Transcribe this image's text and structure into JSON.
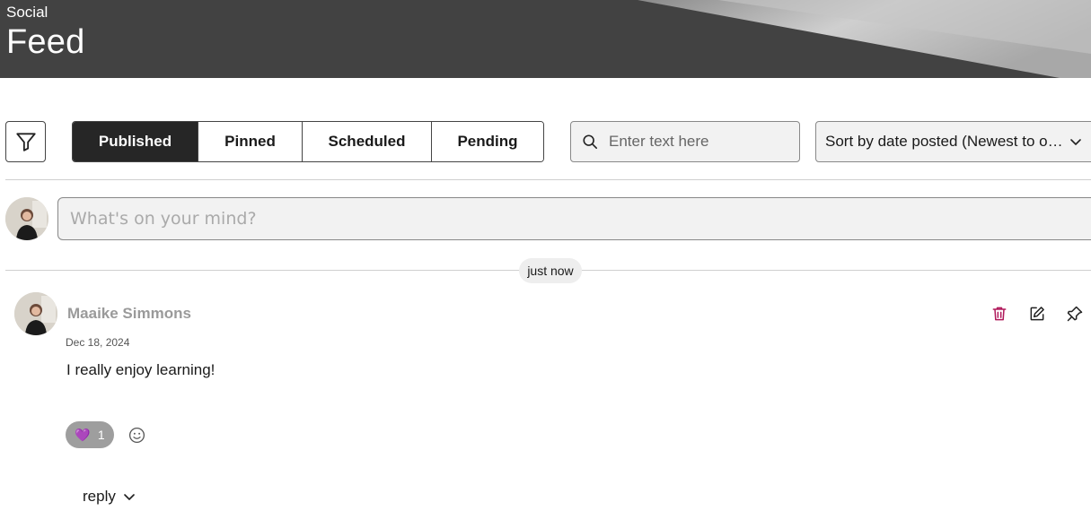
{
  "header": {
    "supertitle": "Social",
    "title": "Feed"
  },
  "toolbar": {
    "filter_icon": "filter-icon",
    "tabs": [
      {
        "label": "Published",
        "active": true
      },
      {
        "label": "Pinned",
        "active": false
      },
      {
        "label": "Scheduled",
        "active": false
      },
      {
        "label": "Pending",
        "active": false
      }
    ],
    "search": {
      "icon": "search-icon",
      "placeholder": "Enter text here",
      "value": ""
    },
    "sort": {
      "label": "Sort by date posted (Newest to oldest)",
      "icon": "chevron-down-icon"
    }
  },
  "composer": {
    "placeholder": "What's on your mind?",
    "value": ""
  },
  "separator": {
    "time_label": "just now"
  },
  "post": {
    "author": "Maaike Simmons",
    "date": "Dec 18, 2024",
    "body": "I really enjoy learning!",
    "actions": [
      "trash-icon",
      "edit-icon",
      "pin-icon"
    ],
    "reaction": {
      "emoji": "💜",
      "count": "1"
    },
    "add_reaction_icon": "smiley-icon",
    "reply_label": "reply"
  },
  "colors": {
    "banner": "#424242",
    "active_tab": "#262626",
    "delete": "#b0185a",
    "reaction_pill": "#9e9e9e"
  }
}
